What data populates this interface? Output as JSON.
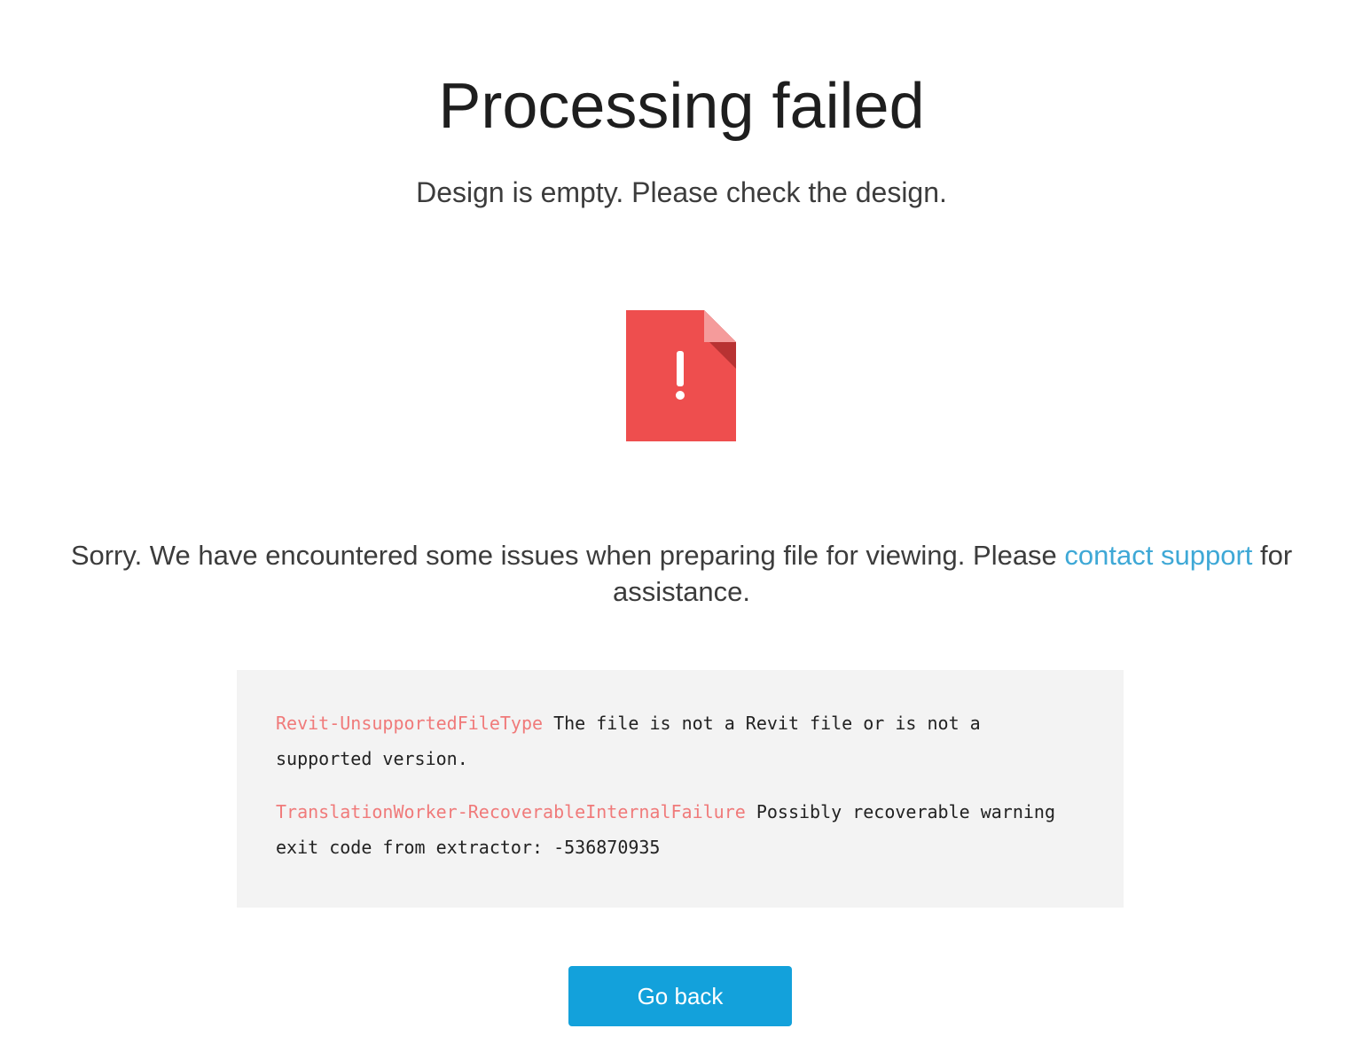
{
  "header": {
    "title": "Processing failed",
    "subtitle": "Design is empty. Please check the design."
  },
  "icon": {
    "name": "file-error-icon",
    "symbol": "!",
    "color": "#ee4e4e",
    "fold_color": "#f59b9b",
    "fold_shadow_color": "#b83232"
  },
  "message": {
    "before_link": "Sorry. We have encountered some issues when preparing file for viewing. Please ",
    "link_text": "contact support",
    "after_link": " for assistance.",
    "link_color": "#3ea8d6"
  },
  "errors": [
    {
      "code": "Revit-UnsupportedFileType",
      "text": " The file is not a Revit file or is not a supported version."
    },
    {
      "code": "TranslationWorker-RecoverableInternalFailure",
      "text": " Possibly recoverable warning exit code from extractor: -536870935"
    }
  ],
  "actions": {
    "go_back_label": "Go back",
    "button_color": "#13a1db"
  }
}
